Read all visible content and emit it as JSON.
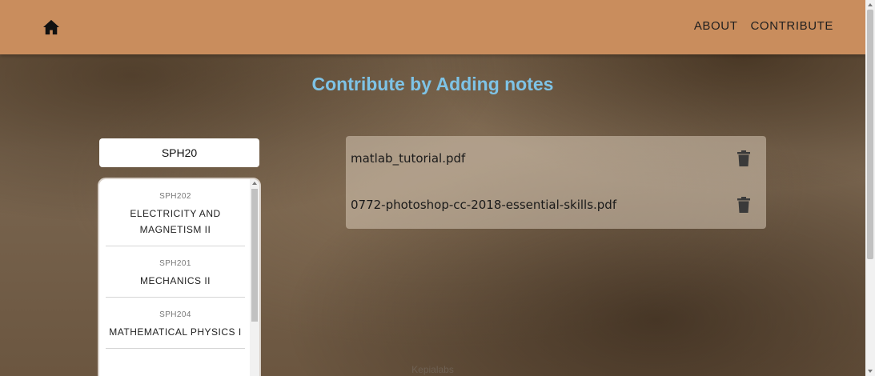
{
  "navbar": {
    "home_icon": "home-icon",
    "links": [
      {
        "label": "ABOUT"
      },
      {
        "label": "CONTRIBUTE"
      }
    ],
    "background_color": "#c98d5d"
  },
  "heading": {
    "text": "Contribute by Adding notes",
    "color": "#7ec3e6"
  },
  "search": {
    "value": "SPH20"
  },
  "courses": [
    {
      "code": "SPH202",
      "name": "ELECTRICITY AND MAGNETISM II"
    },
    {
      "code": "SPH201",
      "name": "MECHANICS II"
    },
    {
      "code": "SPH204",
      "name": "MATHEMATICAL PHYSICS I"
    }
  ],
  "files": [
    {
      "name": "matlab_tutorial.pdf",
      "action_icon": "trash-icon"
    },
    {
      "name": "0772-photoshop-cc-2018-essential-skills.pdf",
      "action_icon": "trash-icon"
    }
  ],
  "footer": {
    "text": "Kepialabs"
  }
}
